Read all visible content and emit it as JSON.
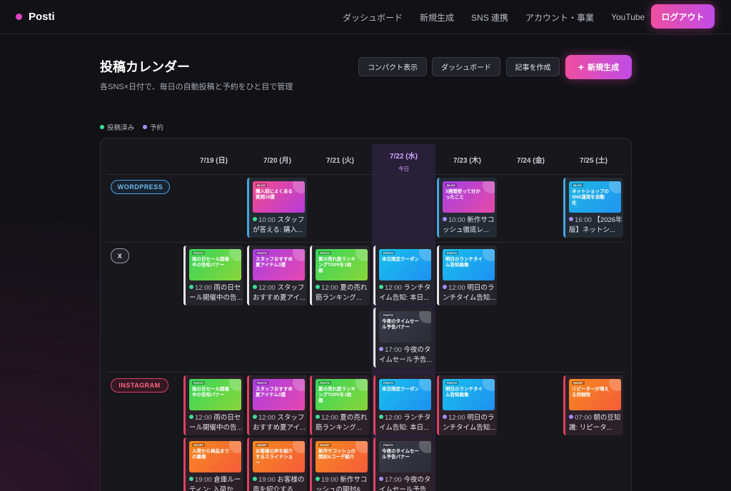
{
  "nav": {
    "brand": "Posti",
    "links": [
      "ダッシュボード",
      "新規生成",
      "SNS 連携",
      "アカウント・事業",
      "YouTube"
    ],
    "logout": "ログアウト"
  },
  "header": {
    "title": "投稿カレンダー",
    "subtitle": "各SNS×日付で、毎日の自動投稿と予約をひと目で管理",
    "buttons": [
      "コンパクト表示",
      "ダッシュボード",
      "記事を作成"
    ],
    "new_button": "新規生成",
    "new_icon": "+"
  },
  "legend": [
    {
      "label": "投稿済み",
      "color": "#3ddc97"
    },
    {
      "label": "予約",
      "color": "#a78bfa"
    }
  ],
  "calendar": {
    "days": [
      "7/19 (日)",
      "7/20 (月)",
      "7/21 (火)",
      "7/22 (水)",
      "7/23 (木)",
      "7/24 (金)",
      "7/25 (土)"
    ],
    "today_label": "今日",
    "sns": [
      "WORDPRESS",
      "X",
      "INSTAGRAM"
    ],
    "posts": [
      {
        "sns": "wp",
        "day": 1,
        "slot": 0,
        "tag": "BLOG",
        "title": "購入前によくある質問10選",
        "time": "10:00",
        "caption": "スタッフが答える: 購入...",
        "status": "posted",
        "grad": [
          "#f24d8c",
          "#b83bd9"
        ]
      },
      {
        "sns": "wp",
        "day": 4,
        "slot": 0,
        "tag": "BLOG",
        "title": "3週間使って分かったこと",
        "time": "10:00",
        "caption": "新作サコッシュ徹底レ...",
        "status": "scheduled",
        "grad": [
          "#a23fe0",
          "#e84aa8"
        ]
      },
      {
        "sns": "wp",
        "day": 6,
        "slot": 0,
        "tag": "BLOG",
        "title": "ネットショップのSNS運用を自動化",
        "time": "16:00",
        "caption": "【2026年版】ネットシ...",
        "status": "scheduled",
        "grad": [
          "#1fb5e0",
          "#2196f3"
        ]
      },
      {
        "sns": "x",
        "day": 0,
        "slot": 0,
        "tag": "PHOTO",
        "title": "雨の日セール開催中の告知バナー",
        "time": "12:00",
        "caption": "雨の日セール開催中の告...",
        "status": "posted",
        "grad": [
          "#36d65a",
          "#8ad63a"
        ]
      },
      {
        "sns": "x",
        "day": 1,
        "slot": 0,
        "tag": "PHOTO",
        "title": "スタッフおすすめ夏アイテム3選",
        "time": "12:00",
        "caption": "スタッフおすすめ夏アイ...",
        "status": "posted",
        "grad": [
          "#a83ee0",
          "#e648b0"
        ]
      },
      {
        "sns": "x",
        "day": 2,
        "slot": 0,
        "tag": "PHOTO",
        "title": "夏の売れ筋ランキングTOP5を1枚画",
        "time": "12:00",
        "caption": "夏の売れ筋ランキング...",
        "status": "posted",
        "grad": [
          "#36d65a",
          "#8ad63a"
        ]
      },
      {
        "sns": "x",
        "day": 3,
        "slot": 0,
        "tag": "PHOTO",
        "title": "本日限定クーポン",
        "time": "12:00",
        "caption": "ランチタイム告知: 本日...",
        "status": "posted",
        "grad": [
          "#18c1ee",
          "#1f8ff0"
        ]
      },
      {
        "sns": "x",
        "day": 4,
        "slot": 0,
        "tag": "PHOTO",
        "title": "明日のランチタイム告知画像",
        "time": "12:00",
        "caption": "明日のランチタイム告知...",
        "status": "scheduled",
        "grad": [
          "#18c1ee",
          "#1f8ff0"
        ]
      },
      {
        "sns": "x",
        "day": 3,
        "slot": 1,
        "tag": "PHOTO",
        "title": "今夜のタイムセール予告バナー",
        "time": "17:00",
        "caption": "今夜のタイムセール予告...",
        "status": "scheduled",
        "grad": [
          "#3a3d4a",
          "#2a2c36"
        ]
      },
      {
        "sns": "ig",
        "day": 0,
        "slot": 0,
        "tag": "PHOTO",
        "title": "雨の日セール開催中の告知バナー",
        "time": "12:00",
        "caption": "雨の日セール開催中の告...",
        "status": "posted",
        "grad": [
          "#36d65a",
          "#8ad63a"
        ]
      },
      {
        "sns": "ig",
        "day": 1,
        "slot": 0,
        "tag": "PHOTO",
        "title": "スタッフおすすめ夏アイテム3選",
        "time": "12:00",
        "caption": "スタッフおすすめ夏アイ...",
        "status": "posted",
        "grad": [
          "#a83ee0",
          "#e648b0"
        ]
      },
      {
        "sns": "ig",
        "day": 2,
        "slot": 0,
        "tag": "PHOTO",
        "title": "夏の売れ筋ランキングTOP5を1枚画",
        "time": "12:00",
        "caption": "夏の売れ筋ランキング...",
        "status": "posted",
        "grad": [
          "#36d65a",
          "#8ad63a"
        ]
      },
      {
        "sns": "ig",
        "day": 3,
        "slot": 0,
        "tag": "PHOTO",
        "title": "本日限定クーポン",
        "time": "12:00",
        "caption": "ランチタイム告知: 本日...",
        "status": "posted",
        "grad": [
          "#18c1ee",
          "#1f8ff0"
        ]
      },
      {
        "sns": "ig",
        "day": 4,
        "slot": 0,
        "tag": "PHOTO",
        "title": "明日のランチタイム告知画像",
        "time": "12:00",
        "caption": "明日のランチタイム告知...",
        "status": "scheduled",
        "grad": [
          "#18c1ee",
          "#1f8ff0"
        ]
      },
      {
        "sns": "ig",
        "day": 6,
        "slot": 0,
        "tag": "SHORT",
        "title": "リピーターが増える同梱物",
        "time": "07:00",
        "caption": "朝の豆知識: リピータ...",
        "status": "scheduled",
        "grad": [
          "#f98a1f",
          "#f45b3a"
        ]
      },
      {
        "sns": "ig",
        "day": 0,
        "slot": 1,
        "tag": "SHORT",
        "title": "入荷から検品までの裏側",
        "time": "19:00",
        "caption": "倉庫ルーティン: 入荷か...",
        "status": "posted",
        "grad": [
          "#f98a1f",
          "#f45b3a"
        ]
      },
      {
        "sns": "ig",
        "day": 1,
        "slot": 1,
        "tag": "SHORT",
        "title": "お客様の声を紹介するスライドショー",
        "time": "19:00",
        "caption": "お客様の声を紹介する...",
        "status": "posted",
        "grad": [
          "#f98a1f",
          "#f45b3a"
        ]
      },
      {
        "sns": "ig",
        "day": 2,
        "slot": 1,
        "tag": "SHORT",
        "title": "新作サコッシュの開封&コーデ紹介",
        "time": "19:00",
        "caption": "新作サコッシュの開封&...",
        "status": "posted",
        "grad": [
          "#f98a1f",
          "#f45b3a"
        ]
      },
      {
        "sns": "ig",
        "day": 3,
        "slot": 1,
        "tag": "PHOTO",
        "title": "今夜のタイムセール予告バナー",
        "time": "17:00",
        "caption": "今夜のタイムセール予告...",
        "status": "scheduled",
        "grad": [
          "#3a3d4a",
          "#2a2c36"
        ]
      }
    ]
  },
  "colors": {
    "posted": "#3ddc97",
    "scheduled": "#a78bfa",
    "accent": "#e244c7"
  }
}
